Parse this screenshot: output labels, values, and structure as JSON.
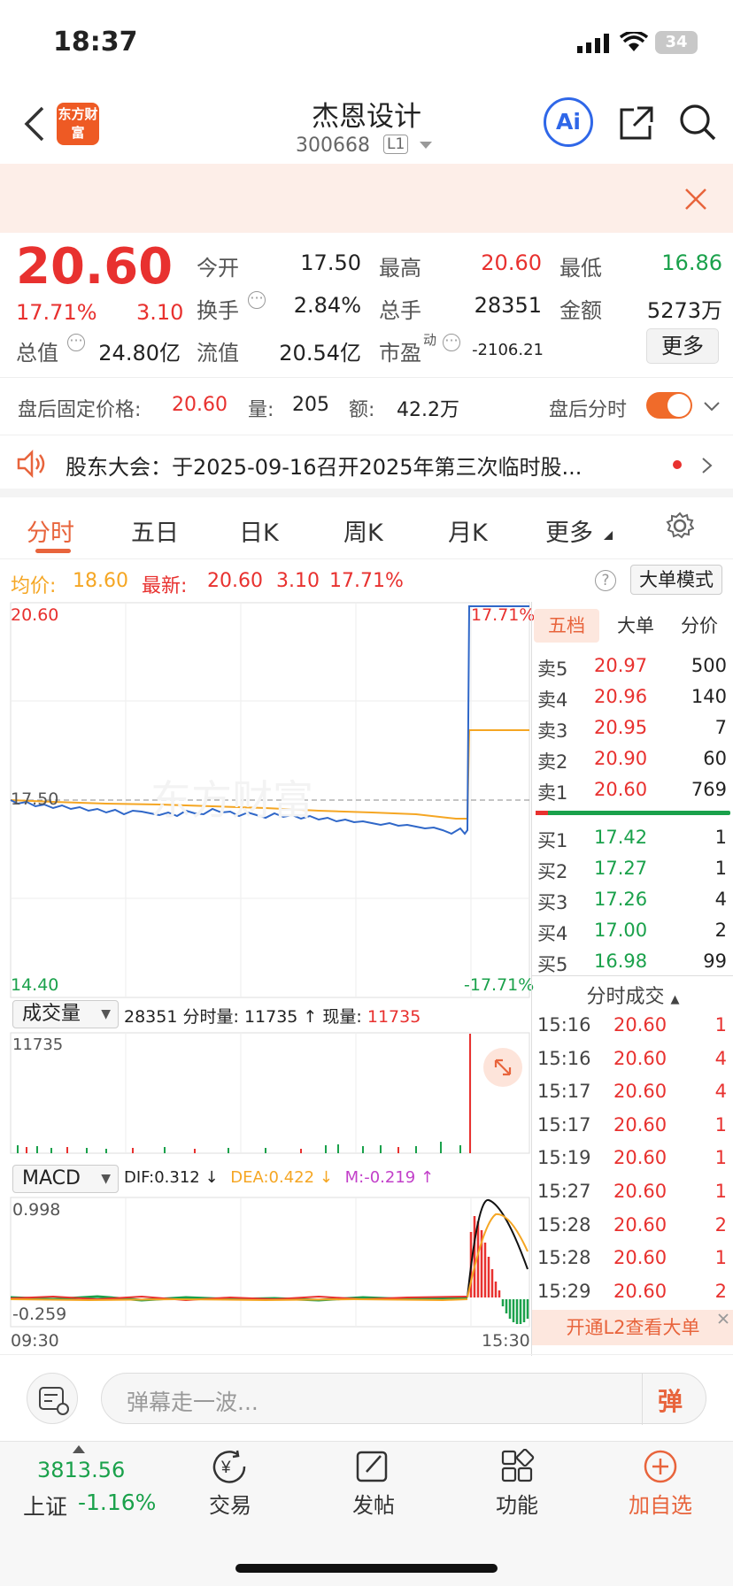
{
  "status": {
    "time": "18:37",
    "battery": "34"
  },
  "header": {
    "title": "杰恩设计",
    "code": "300668",
    "level": "L1",
    "logo_text": "东方财富",
    "ai_label": "Ai"
  },
  "quote": {
    "price": "20.60",
    "pct": "17.71%",
    "change": "3.10",
    "stats": [
      {
        "label": "今开",
        "value": "17.50",
        "color": "#222"
      },
      {
        "label": "最高",
        "value": "20.60",
        "color": "#e8312f"
      },
      {
        "label": "最低",
        "value": "16.86",
        "color": "#1aa14b"
      },
      {
        "label": "换手",
        "value": "2.84%",
        "color": "#222"
      },
      {
        "label": "总手",
        "value": "28351",
        "color": "#222"
      },
      {
        "label": "金额",
        "value": "5273万",
        "color": "#222"
      },
      {
        "label": "总值",
        "value": "24.80亿",
        "color": "#222"
      },
      {
        "label": "流值",
        "value": "20.54亿",
        "color": "#222"
      },
      {
        "label": "市盈",
        "value": "-2106.21",
        "color": "#222"
      }
    ],
    "pe_sup": "动",
    "more_label": "更多"
  },
  "afterhours": {
    "label": "盘后固定价格:",
    "price": "20.60",
    "vol_label": "量:",
    "vol": "205",
    "amt_label": "额:",
    "amt": "42.2万",
    "toggle_label": "盘后分时"
  },
  "notice": {
    "text": "股东大会：于2025-09-16召开2025年第三次临时股..."
  },
  "tabs": [
    "分时",
    "五日",
    "日K",
    "周K",
    "月K",
    "更多"
  ],
  "infoline": {
    "avg_label": "均价:",
    "avg": "18.60",
    "last_label": "最新:",
    "last": "20.60",
    "chg": "3.10",
    "pct": "17.71%",
    "bigorder_label": "大单模式"
  },
  "chart": {
    "y_top": "20.60",
    "y_mid": "17.50",
    "y_bottom": "14.40",
    "pct_top": "17.71%",
    "pct_bottom": "-17.71%",
    "vol_selector": "成交量",
    "vol_info_total": "28351",
    "vol_info_label1": "分时量:",
    "vol_info_val1": "11735",
    "vol_info_label2": "现量:",
    "vol_info_val2": "11735",
    "vol_max": "11735",
    "macd_selector": "MACD",
    "dif": "DIF:0.312 ↓",
    "dea": "DEA:0.422 ↓",
    "m": "M:-0.219 ↑",
    "macd_top": "0.998",
    "macd_bottom": "-0.259",
    "time_start": "09:30",
    "time_end": "15:30",
    "watermark": "东方财富"
  },
  "orderbook": {
    "tabs": [
      "五档",
      "大单",
      "分价"
    ],
    "asks": [
      {
        "label": "卖5",
        "price": "20.97",
        "vol": "500"
      },
      {
        "label": "卖4",
        "price": "20.96",
        "vol": "140"
      },
      {
        "label": "卖3",
        "price": "20.95",
        "vol": "7"
      },
      {
        "label": "卖2",
        "price": "20.90",
        "vol": "60"
      },
      {
        "label": "卖1",
        "price": "20.60",
        "vol": "769"
      }
    ],
    "bids": [
      {
        "label": "买1",
        "price": "17.42",
        "vol": "1"
      },
      {
        "label": "买2",
        "price": "17.27",
        "vol": "1"
      },
      {
        "label": "买3",
        "price": "17.26",
        "vol": "4"
      },
      {
        "label": "买4",
        "price": "17.00",
        "vol": "2"
      },
      {
        "label": "买5",
        "price": "16.98",
        "vol": "99"
      }
    ],
    "trades_title": "分时成交",
    "trades": [
      {
        "time": "15:16",
        "price": "20.60",
        "vol": "1"
      },
      {
        "time": "15:16",
        "price": "20.60",
        "vol": "4"
      },
      {
        "time": "15:17",
        "price": "20.60",
        "vol": "4"
      },
      {
        "time": "15:17",
        "price": "20.60",
        "vol": "1"
      },
      {
        "time": "15:19",
        "price": "20.60",
        "vol": "1"
      },
      {
        "time": "15:27",
        "price": "20.60",
        "vol": "1"
      },
      {
        "time": "15:28",
        "price": "20.60",
        "vol": "2"
      },
      {
        "time": "15:28",
        "price": "20.60",
        "vol": "1"
      },
      {
        "time": "15:29",
        "price": "20.60",
        "vol": "2"
      }
    ],
    "l2_label": "开通L2查看大单"
  },
  "bottombar": {
    "placeholder": "弹幕走一波...",
    "danmu_label": "弹"
  },
  "navbar": {
    "index_value": "3813.56",
    "index_name": "上证",
    "index_pct": "-1.16%",
    "items": [
      "交易",
      "发帖",
      "功能",
      "加自选"
    ]
  }
}
